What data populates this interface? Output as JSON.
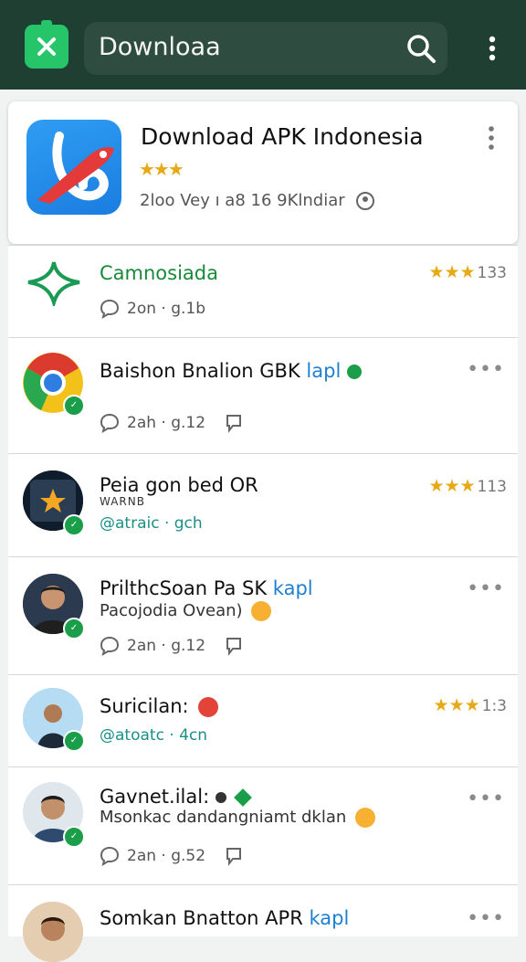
{
  "topbar": {
    "search_text": "Downloaa",
    "logo_icon": "close-icon"
  },
  "featured": {
    "title": "Download APK Indonesia",
    "stars": "★★★",
    "meta": "2loo Vey ı a8 16 9Klndiar"
  },
  "list": [
    {
      "title": "Camnosiada",
      "meta": "2on · g.1b",
      "rating_stars": "★★★",
      "rating_value": "133"
    },
    {
      "title": "Baishon Bnalion GBK",
      "tag": "lapl",
      "meta": "2ah · g.12"
    },
    {
      "title": "Peia gon bed OR",
      "subtitle": "WARNB",
      "meta": "@atraic · gch",
      "rating_stars": "★★★",
      "rating_value": "113"
    },
    {
      "title": "PrilthcSoan Pa SK",
      "tag": "kapl",
      "subtitle": "Pacojodia Ovean)",
      "meta": "2an · g.12"
    },
    {
      "title": "Suricilan:",
      "meta": "@atoatc · 4cn",
      "rating_stars": "★★★",
      "rating_value": "1:3"
    },
    {
      "title": "Gavnet.ilal:",
      "subtitle": "Msonkac dandangniamt dklan",
      "meta": "2an · g.52"
    },
    {
      "title": "Somkan Bnatton APR",
      "tag": "kapl"
    }
  ],
  "colors": {
    "topbar": "#1f3f32",
    "accent_green": "#27c56a",
    "star": "#e7a917",
    "teal_text": "#1b8f86"
  }
}
